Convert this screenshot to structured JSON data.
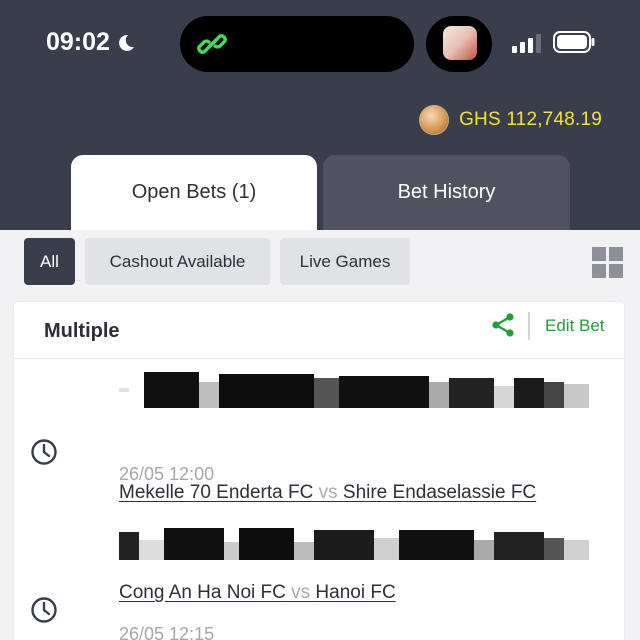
{
  "status_bar": {
    "time": "09:02",
    "icons": [
      "moon-icon",
      "link-icon",
      "recording-thumbnail",
      "signal-icon",
      "battery-icon"
    ]
  },
  "header": {
    "balance": "GHS 112,748.19",
    "balance_color": "#f4e524"
  },
  "tabs": [
    {
      "label": "Open Bets (1)",
      "active": true
    },
    {
      "label": "Bet History",
      "active": false
    }
  ],
  "filters": [
    {
      "label": "All",
      "active": true
    },
    {
      "label": "Cashout Available",
      "active": false
    },
    {
      "label": "Live Games",
      "active": false
    }
  ],
  "bet": {
    "title": "Multiple",
    "edit_label": "Edit Bet",
    "accent_color": "#1fa13a",
    "legs": [
      {
        "home": "Mekelle 70 Enderta FC",
        "vs": "vs",
        "away": "Shire Endaselassie FC",
        "time": "26/05 12:00"
      },
      {
        "home": "Cong An Ha Noi FC",
        "vs": "vs",
        "away": "Hanoi FC",
        "time": "26/05 12:15"
      }
    ]
  }
}
